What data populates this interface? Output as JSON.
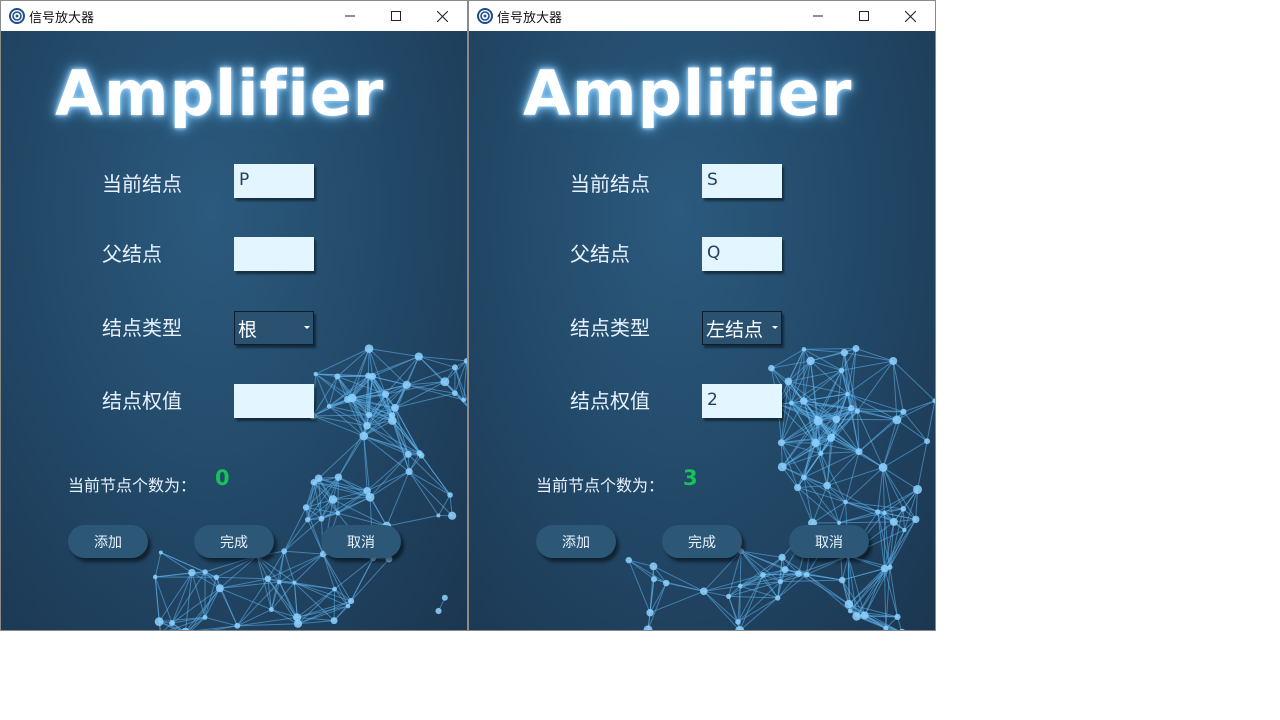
{
  "windows": [
    {
      "title": "信号放大器",
      "heading": "Amplifier",
      "labels": {
        "current_node": "当前结点",
        "parent_node": "父结点",
        "node_type": "结点类型",
        "node_weight": "结点权值"
      },
      "fields": {
        "current_node_value": "P",
        "parent_node_value": "",
        "node_type_selected": "根",
        "node_weight_value": ""
      },
      "count_label": "当前节点个数为：",
      "count_value": "0",
      "buttons": {
        "add": "添加",
        "done": "完成",
        "cancel": "取消"
      }
    },
    {
      "title": "信号放大器",
      "heading": "Amplifier",
      "labels": {
        "current_node": "当前结点",
        "parent_node": "父结点",
        "node_type": "结点类型",
        "node_weight": "结点权值"
      },
      "fields": {
        "current_node_value": "S",
        "parent_node_value": "Q",
        "node_type_selected": "左结点",
        "node_weight_value": "2"
      },
      "count_label": "当前节点个数为：",
      "count_value": "3",
      "buttons": {
        "add": "添加",
        "done": "完成",
        "cancel": "取消"
      }
    }
  ],
  "icons": {
    "app": "target-icon",
    "minimize": "minimize-icon",
    "maximize": "maximize-icon",
    "close": "close-icon"
  },
  "colors": {
    "background": "#234a6a",
    "field_bg": "#e3f6ff",
    "count_value": "#14c45a",
    "button_bg": "#2c5777",
    "network_line": "#5fb4ef"
  }
}
